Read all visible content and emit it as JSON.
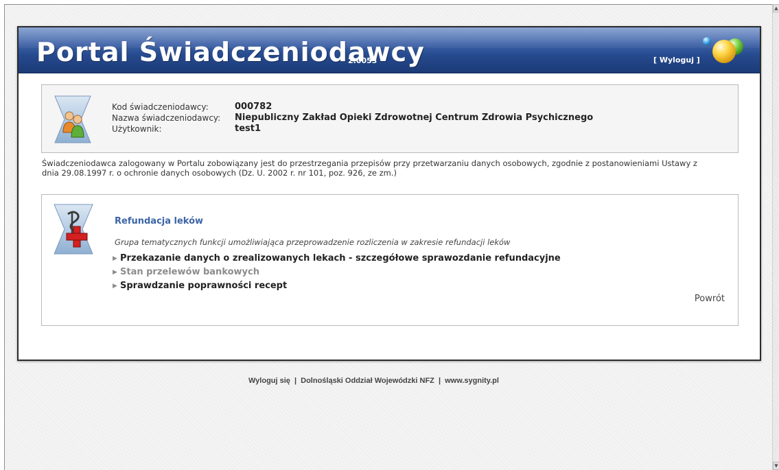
{
  "header": {
    "title": "Portal Świadczeniodawcy",
    "version": "2.0053",
    "logout_link": "[ Wyloguj ]"
  },
  "provider": {
    "labels": {
      "code": "Kod świadczeniodawcy:",
      "name": "Nazwa świadczeniodawcy:",
      "user": "Użytkownik:"
    },
    "code": "000782",
    "name": "Niepubliczny Zakład Opieki Zdrowotnej Centrum Zdrowia Psychicznego",
    "user": "test1"
  },
  "notice": {
    "line1": "Świadczeniodawca zalogowany w Portalu zobowiązany jest do przestrzegania przepisów przy przetwarzaniu danych osobowych, zgodnie z postanowieniami Ustawy z",
    "line2": "dnia 29.08.1997 r. o ochronie danych osobowych (Dz. U. 2002 r. nr 101, poz. 926, ze zm.)"
  },
  "module": {
    "title": "Refundacja leków",
    "description": "Grupa tematycznych funkcji umożliwiająca przeprowadzenie rozliczenia w zakresie refundacji leków",
    "links": [
      {
        "label": "Przekazanie danych o zrealizowanych lekach - szczegółowe sprawozdanie refundacyjne",
        "enabled": true
      },
      {
        "label": "Stan przelewów bankowych",
        "enabled": false
      },
      {
        "label": "Sprawdzanie poprawności recept",
        "enabled": true
      }
    ],
    "back_label": "Powrót"
  },
  "footer": {
    "logout": "Wyloguj się",
    "separator": "|",
    "branch": "Dolnośląski Oddział Wojewódzki NFZ",
    "website": "www.sygnity.pl"
  },
  "icons": {
    "provider": "people-icon",
    "module": "pharmacy-cross-icon",
    "logo": "colored-balls-logo",
    "link_arrow": "triangle-right-icon"
  },
  "colors": {
    "header_top": "#6b8bc6",
    "header_bottom": "#1b3a77",
    "module_title": "#3b64a6",
    "disabled_link": "#8c8c8c"
  }
}
